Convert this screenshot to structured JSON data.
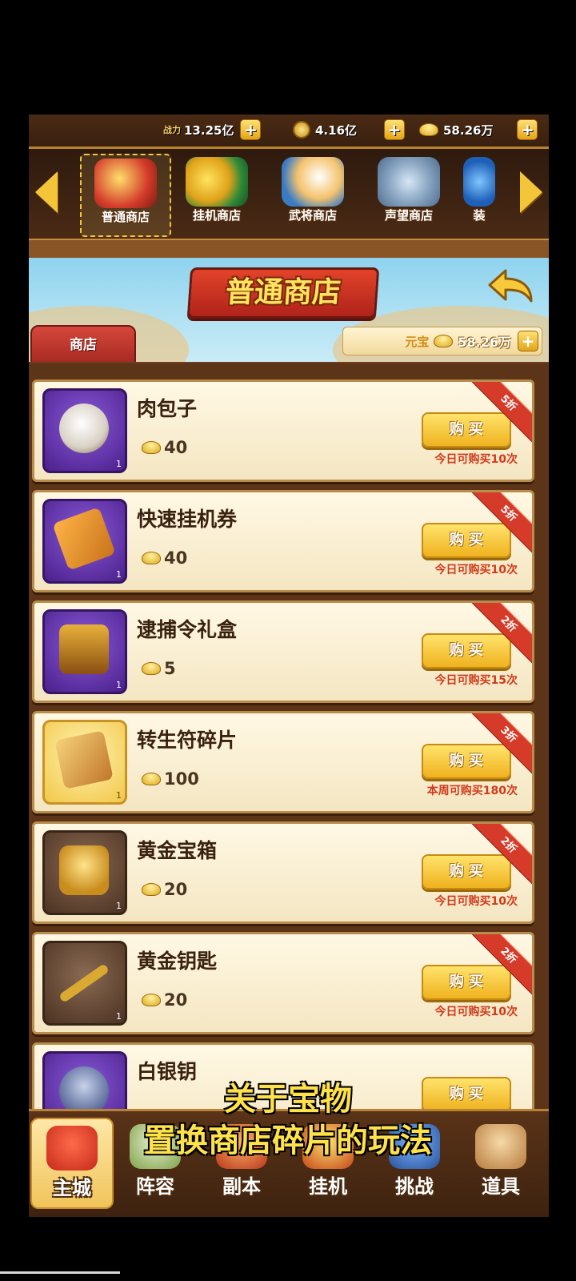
{
  "top_bar": {
    "power_label": "战力",
    "power_value": "13.25亿",
    "coins_value": "4.16亿",
    "ingots_value": "58.26万",
    "plus": "+"
  },
  "tabs": [
    {
      "label": "普通商店",
      "icon": "treasure-chest-icon"
    },
    {
      "label": "挂机商店",
      "icon": "gold-coin-icon"
    },
    {
      "label": "武将商店",
      "icon": "chef-hero-icon"
    },
    {
      "label": "声望商店",
      "icon": "armor-icon"
    },
    {
      "label": "装",
      "icon": "blue-item-icon"
    }
  ],
  "header": {
    "title": "普通商店",
    "shop_tag": "商店",
    "yuanbao_label": "元宝",
    "yuanbao_value": "58.26万"
  },
  "items": [
    {
      "name": "肉包子",
      "price": "40",
      "discount": "5折",
      "limit": "今日可购买10次",
      "qty": "1",
      "frame": "purple"
    },
    {
      "name": "快速挂机券",
      "price": "40",
      "discount": "5折",
      "limit": "今日可购买10次",
      "qty": "1",
      "frame": "purple"
    },
    {
      "name": "逮捕令礼盒",
      "price": "5",
      "discount": "2折",
      "limit": "今日可购买15次",
      "qty": "1",
      "frame": "purple"
    },
    {
      "name": "转生符碎片",
      "price": "100",
      "discount": "3折",
      "limit": "本周可购买180次",
      "qty": "1",
      "frame": "gold"
    },
    {
      "name": "黄金宝箱",
      "price": "20",
      "discount": "2折",
      "limit": "今日可购买10次",
      "qty": "1",
      "frame": "brown"
    },
    {
      "name": "黄金钥匙",
      "price": "20",
      "discount": "2折",
      "limit": "今日可购买10次",
      "qty": "1",
      "frame": "brown"
    },
    {
      "name": "白银钥",
      "price": "",
      "discount": "",
      "limit": "",
      "qty": "",
      "frame": "purple"
    }
  ],
  "buy_label": "购 买",
  "subtitles": {
    "line1": "关于宝物",
    "line2": "置换商店碎片的玩法"
  },
  "bottom_nav": [
    {
      "label": "主城",
      "icon": "castle-icon"
    },
    {
      "label": "阵容",
      "icon": "lineup-icon"
    },
    {
      "label": "副本",
      "icon": "dungeon-icon"
    },
    {
      "label": "挂机",
      "icon": "idle-icon"
    },
    {
      "label": "挑战",
      "icon": "challenge-icon"
    },
    {
      "label": "道具",
      "icon": "bag-icon"
    }
  ],
  "colors": {
    "gold": "#f3c63a",
    "discount_red": "#d63b2a",
    "limit_red": "#d03a1a"
  }
}
